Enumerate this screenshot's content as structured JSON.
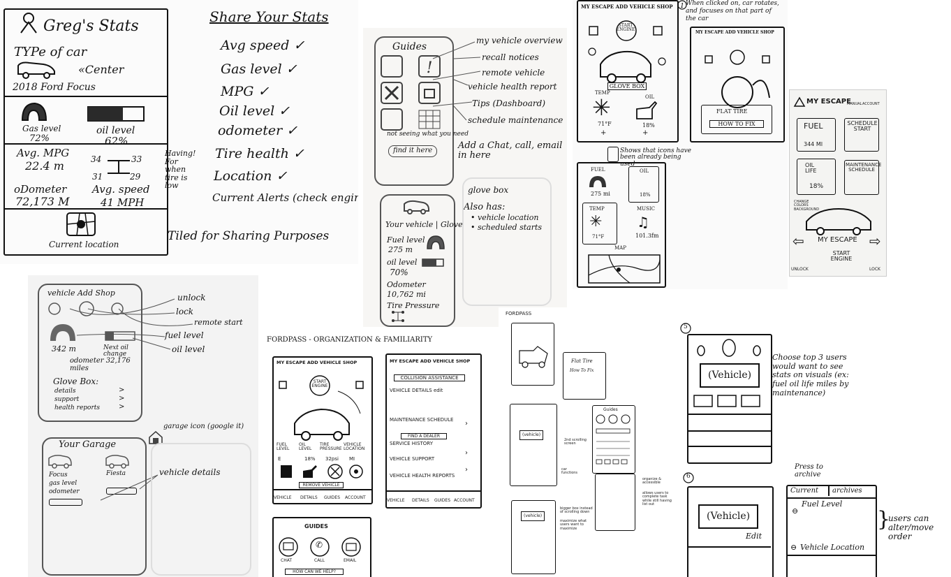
{
  "stats_panel": {
    "title": "Greg's Stats",
    "type_of_car": "TYPe of car",
    "center": "«Center",
    "car_model": "2018 Ford Focus",
    "gas_label": "Gas level",
    "gas_value": "72%",
    "oil_label": "oil level",
    "oil_value": "62%",
    "mpg_label": "Avg. MPG",
    "mpg_value": "22.4 m",
    "tire_values": [
      "34",
      "33",
      "31",
      "29"
    ],
    "tire_note": "Having! For when tire is low",
    "odometer_label": "oDometer",
    "odometer_value": "72,173 M",
    "speed_label": "Avg. speed",
    "speed_value": "41 MPH",
    "location_label": "Current location"
  },
  "share_list": {
    "title": "Share Your Stats",
    "items": [
      "Avg speed ✓",
      "Gas level ✓",
      "MPG ✓",
      "Oil level ✓",
      "odometer ✓",
      "Tire health ✓",
      "Location ✓",
      "Current Alerts (check engine)"
    ],
    "footer": "Tiled for Sharing Purposes"
  },
  "guides_panel": {
    "title": "Guides",
    "notes": [
      "my vehicle overview",
      "recall notices",
      "remote vehicle",
      "vehicle health report",
      "Tips (Dashboard)",
      "schedule maintenance"
    ],
    "search_prompt": "not seeing what you need",
    "search_button": "find it here",
    "chat_note": "Add a Chat, call, email in here",
    "glovebox_note": "glove box",
    "also_has_title": "Also has:",
    "also_has_items": [
      "• vehicle location",
      "• scheduled starts"
    ],
    "vehicle_title": "Your vehicle | Glove",
    "fuel_label": "Fuel level",
    "fuel_value": "275 m",
    "oil_label": "oil level",
    "oil_value": "70%",
    "odometer_label": "Odometer",
    "odometer_value": "10,762 mi",
    "tire_label": "Tire Pressure"
  },
  "escape_sketch": {
    "header": "MY ESCAPE ADD VEHICLE SHOP",
    "start_engine": "START ENGINE",
    "glove_box": "GLOVE BOX",
    "temp_label": "TEMP",
    "temp_value": "71°F",
    "oil_label": "OIL",
    "oil_value": "18%",
    "note_rotate": "When clicked on, car rotates, and focuses on that part of the car",
    "flat_tire": "FLAT TIRE",
    "how_to_fix": "HOW TO FIX",
    "icons_note": "Shows that icons have been already being used",
    "fuel_label": "FUEL",
    "fuel_value": "275 mi",
    "music_label": "MUSIC",
    "music_value": "101.3fm",
    "map_label": "MAP"
  },
  "escape_phone": {
    "title": "MY ESCAPE",
    "manual": "MANUAL",
    "account": "ACCOUNT",
    "fuel_label": "FUEL",
    "fuel_value": "344 MI",
    "schedule_start": "SCHEDULE START",
    "oil_life": "OIL LIFE",
    "oil_value": "18%",
    "maintenance": "MAINTENANCE SCHEDULE",
    "change_colors": "CHANGE COLORS BACKGROUND",
    "car_name": "MY ESCAPE",
    "start_engine": "START ENGINE",
    "unlock": "UNLOCK",
    "lock": "LOCK"
  },
  "vehicle_add": {
    "header": "vehicle Add Shop",
    "labels": [
      "unlock",
      "lock",
      "remote start",
      "fuel level",
      "oil level"
    ],
    "fuel_value": "342 m",
    "oil_note": "Next oil change",
    "odometer": "odometer 32,176 miles",
    "glovebox_title": "Glove Box:",
    "glovebox_items": [
      "details",
      "support",
      "health reports"
    ],
    "garage_icon_note": "garage icon (google it)",
    "garage_title": "Your Garage",
    "car1_name": "Focus",
    "car1_gas": "gas level",
    "car1_odo": "odometer",
    "car2_name": "Fiesta",
    "details_note": "vehicle details"
  },
  "fordpass_org": {
    "title": "FORDPASS - ORGANIZATION & FAMILIARITY",
    "header": "MY ESCAPE ADD VEHICLE SHOP",
    "start_engine": "START ENGINE",
    "metrics": [
      "FUEL LEVEL",
      "OIL LEVEL",
      "TIRE PRESSURE",
      "VEHICLE LOCATION"
    ],
    "metric_values": [
      "E",
      "18%",
      "32psi",
      "MI"
    ],
    "remove_vehicle": "REMOVE VEHICLE",
    "nav": [
      "VEHICLE",
      "DETAILS",
      "GUIDES",
      "ACCOUNT"
    ],
    "details_header": "MY ESCAPE ADD VEHICLE SHOP",
    "collision": "COLLISION ASSISTANCE",
    "details_items": [
      "VEHICLE DETAILS edit",
      "MAINTENANCE SCHEDULE",
      "FIND A DEALER",
      "SERVICE HISTORY",
      "VEHICLE SUPPORT",
      "VEHICLE HEALTH REPORTS"
    ],
    "guides_title": "GUIDES",
    "guides_actions": [
      "CHAT",
      "CALL",
      "EMAIL"
    ],
    "guides_search": "HOW CAN WE HELP?"
  },
  "fordpass_small": {
    "title": "FORDPASS",
    "flat_tire": "Flat Tire",
    "how_to_fix": "How To Fix",
    "vehicle": "(vehicle)",
    "guides": "Guides",
    "notes": [
      "2nd scrolling screen",
      "car functions",
      "organize & accessible",
      "allows users to complete task while still having list out",
      "bigger box instead of scrolling down",
      "maximize what users want to maximize"
    ]
  },
  "choose_panel": {
    "step1": "5",
    "step2": "6",
    "vehicle": "(Vehicle)",
    "note": "Choose top 3 users would want to see stats on visuals (ex: fuel oil life miles by maintenance)",
    "press_note": "Press to archive",
    "tabs": [
      "Current",
      "archives"
    ],
    "fuel_level": "Fuel Level",
    "edit": "Edit",
    "vehicle_location": "Vehicle Location",
    "alter_note": "users can alter/move order"
  }
}
